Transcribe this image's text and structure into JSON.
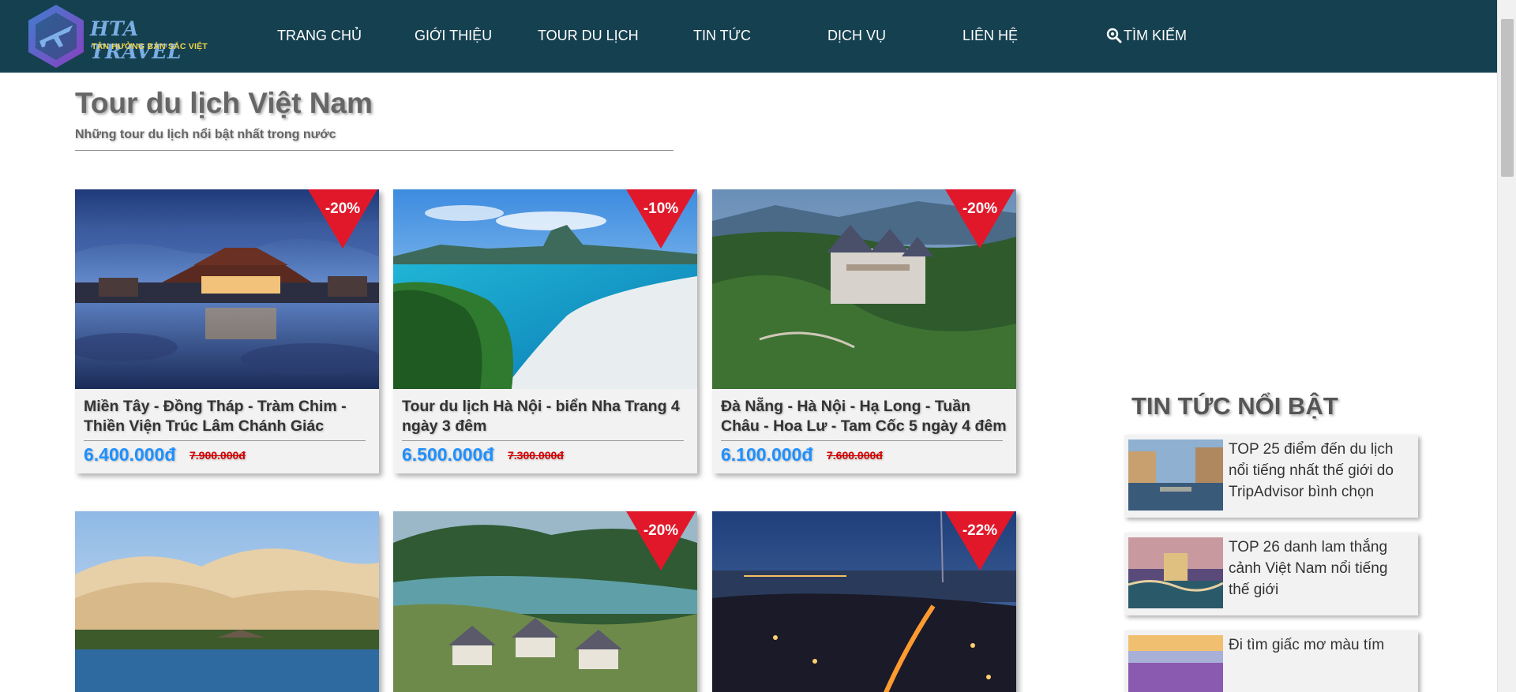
{
  "nav": {
    "logo": {
      "brand": "HTA TRAVEL",
      "tagline": "TẬN HƯỞNG BẢN SẮC VIỆT"
    },
    "items": [
      {
        "label": "TRANG CHỦ"
      },
      {
        "label": "GIỚI THIỆU"
      },
      {
        "label": "TOUR DU LỊCH"
      },
      {
        "label": "TIN TỨC"
      },
      {
        "label": "DỊCH VỤ"
      },
      {
        "label": "LIÊN HỆ"
      }
    ],
    "search": {
      "label": "TÌM KIẾM",
      "icon": "search-icon"
    }
  },
  "section": {
    "title": "Tour du lịch Việt Nam",
    "subtitle": "Những tour du lịch nổi bật nhất trong nước"
  },
  "tours": [
    {
      "title": "Miền Tây - Đồng Tháp - Tràm Chim - Thiền Viện Trúc Lâm Chánh Giác",
      "price": "6.400.000đ",
      "old_price": "7.900.000đ",
      "discount": "-20%",
      "image": "pagoda-lake-dusk"
    },
    {
      "title": "Tour du lịch Hà Nội - biển Nha Trang 4 ngày 3 đêm",
      "price": "6.500.000đ",
      "old_price": "7.300.000đ",
      "discount": "-10%",
      "image": "tropical-beach"
    },
    {
      "title": "Đà Nẵng - Hà Nội - Hạ Long - Tuần Châu - Hoa Lư - Tam Cốc 5 ngày 4 đêm",
      "price": "6.100.000đ",
      "old_price": "7.600.000đ",
      "discount": "-20%",
      "image": "mountain-castle"
    },
    {
      "title": "",
      "price": "",
      "old_price": "",
      "discount": "",
      "image": "sand-dunes"
    },
    {
      "title": "",
      "price": "",
      "old_price": "",
      "discount": "-20%",
      "image": "lake-village"
    },
    {
      "title": "",
      "price": "",
      "old_price": "",
      "discount": "-22%",
      "image": "city-night"
    }
  ],
  "news": {
    "title": "TIN TỨC NỔI BẬT",
    "items": [
      {
        "text": "TOP 25 điểm đến du lịch nổi tiếng nhất thế giới do TripAdvisor bình chọn",
        "image": "canal-city"
      },
      {
        "text": "TOP 26 danh lam thắng cảnh Việt Nam nổi tiếng thế giới",
        "image": "bay-hotel"
      },
      {
        "text": "Đi tìm giấc mơ màu tím",
        "image": "lavender-field"
      }
    ]
  },
  "colors": {
    "nav_bg": "#15404f",
    "price": "#1e90ff",
    "old_price": "#d80000",
    "badge": "#e0182a"
  }
}
